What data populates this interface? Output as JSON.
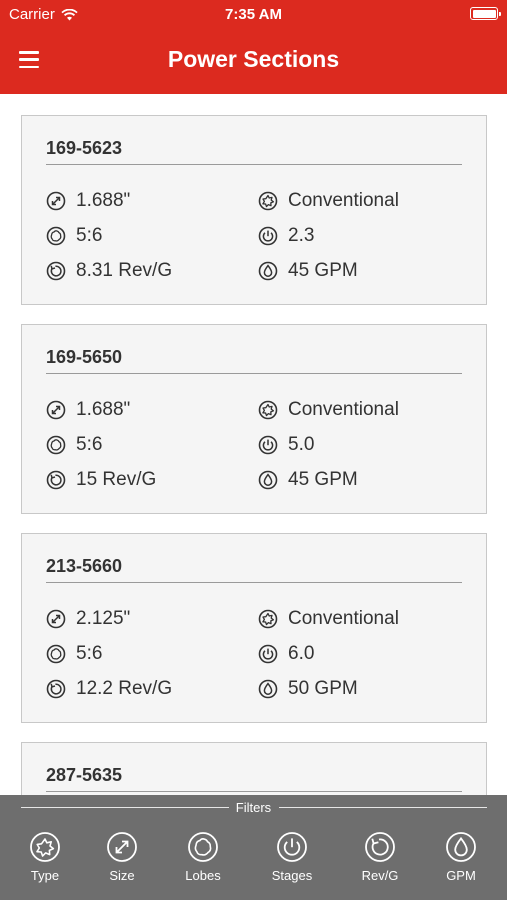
{
  "status_bar": {
    "carrier": "Carrier",
    "time": "7:35 AM"
  },
  "nav": {
    "title": "Power Sections"
  },
  "cards": [
    {
      "code": "169-5623",
      "diameter": "1.688\"",
      "type": "Conventional",
      "lobes": "5:6",
      "stages": "2.3",
      "rev": "8.31 Rev/G",
      "gpm": "45 GPM"
    },
    {
      "code": "169-5650",
      "diameter": "1.688\"",
      "type": "Conventional",
      "lobes": "5:6",
      "stages": "5.0",
      "rev": "15 Rev/G",
      "gpm": "45 GPM"
    },
    {
      "code": "213-5660",
      "diameter": "2.125\"",
      "type": "Conventional",
      "lobes": "5:6",
      "stages": "6.0",
      "rev": "12.2 Rev/G",
      "gpm": "50 GPM"
    },
    {
      "code": "287-5635"
    }
  ],
  "filters": {
    "label": "Filters",
    "items": [
      {
        "label": "Type",
        "icon": "type-icon"
      },
      {
        "label": "Size",
        "icon": "size-icon"
      },
      {
        "label": "Lobes",
        "icon": "lobes-icon"
      },
      {
        "label": "Stages",
        "icon": "stages-icon"
      },
      {
        "label": "Rev/G",
        "icon": "rev-icon"
      },
      {
        "label": "GPM",
        "icon": "gpm-icon"
      }
    ]
  },
  "colors": {
    "header": "#dc2a1f",
    "filter_bar": "#6e6e6e",
    "card_bg": "#f5f5f5"
  }
}
